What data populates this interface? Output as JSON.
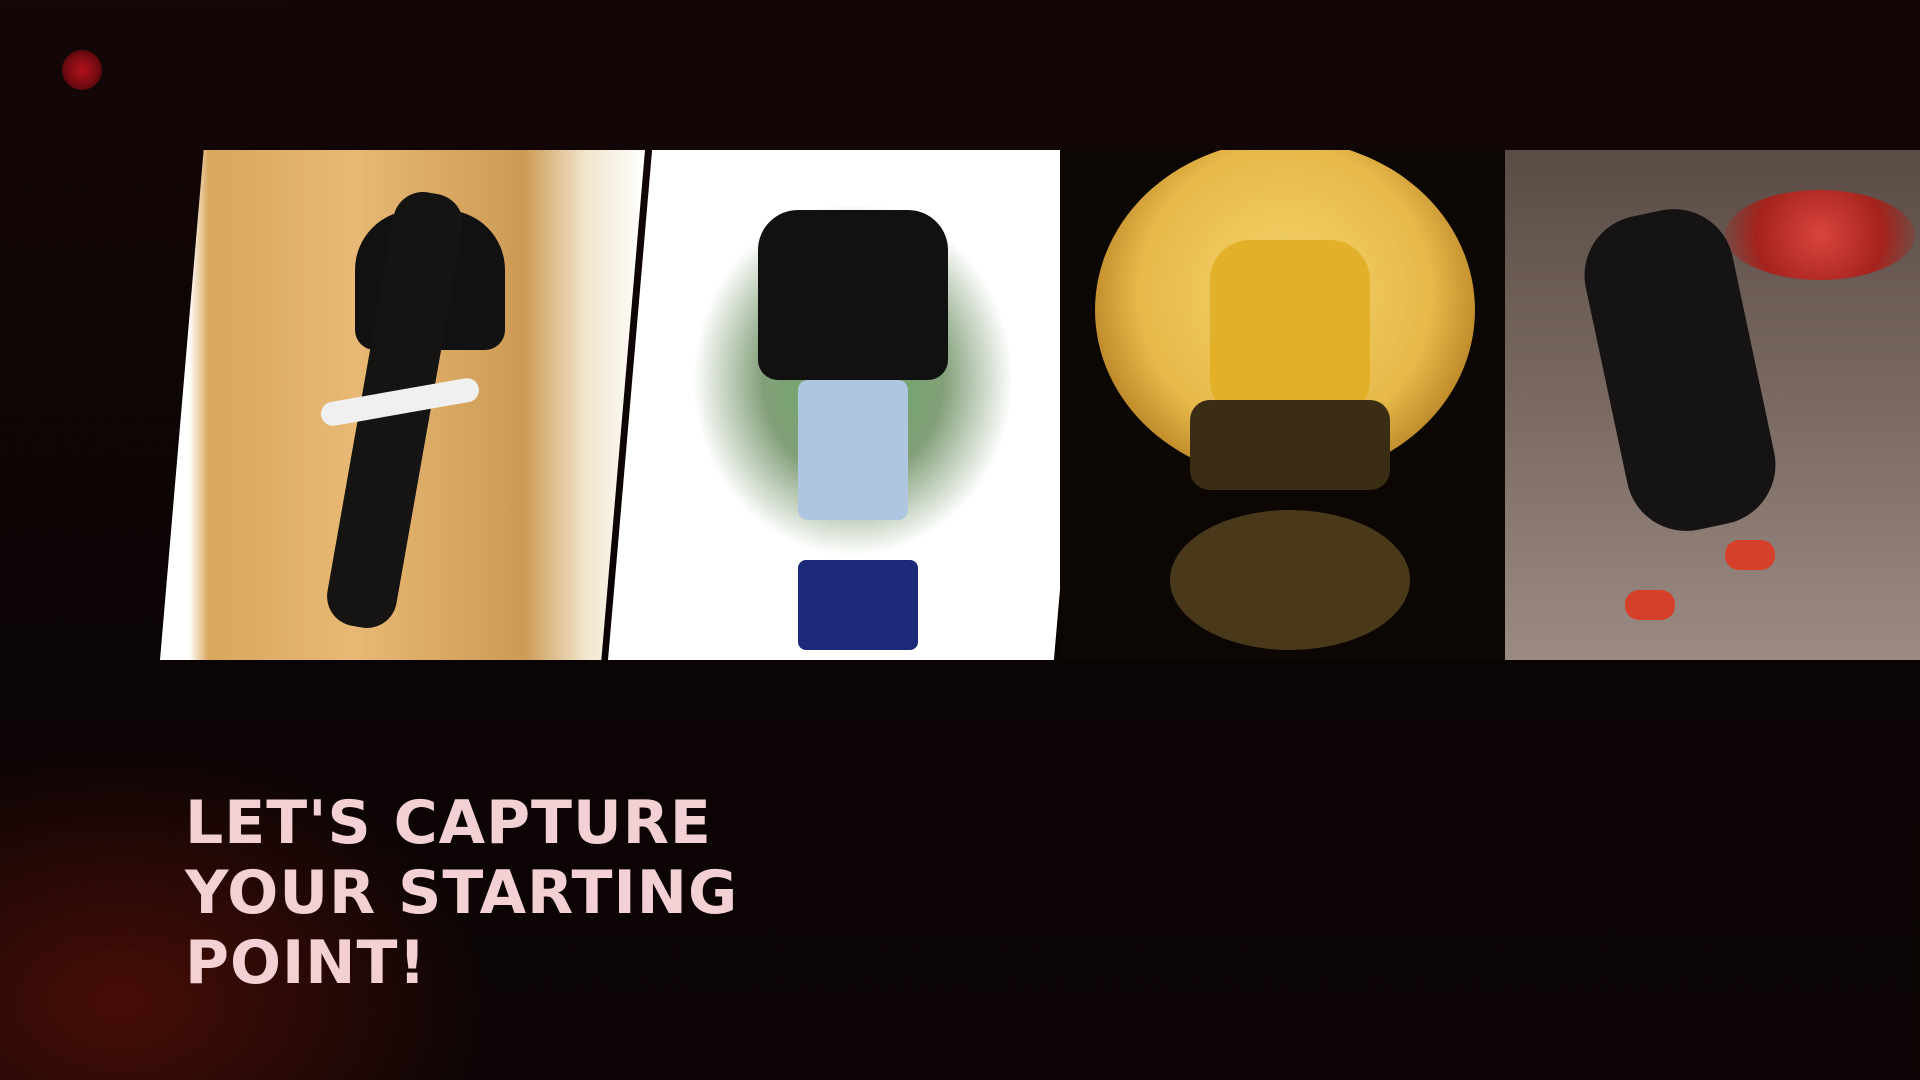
{
  "brand": {
    "logo": "red-dot-logo",
    "accent_color": "#b3121b"
  },
  "gallery": {
    "cards": [
      {
        "name": "athlete-card-1",
        "image": "athlete in black outfit on gold marble background"
      },
      {
        "name": "athlete-card-2",
        "image": "athlete in black tee and denim shorts on green smoke background"
      },
      {
        "name": "athlete-card-3",
        "image": "athlete in yellow crouching in front of golden moon"
      },
      {
        "name": "athlete-card-4",
        "image": "athlete in black lunging in arena with red banner"
      }
    ]
  },
  "hero": {
    "headline": "LET'S CAPTURE YOUR STARTING POINT!",
    "body": "",
    "primary_link": "",
    "secondary_link": ""
  }
}
